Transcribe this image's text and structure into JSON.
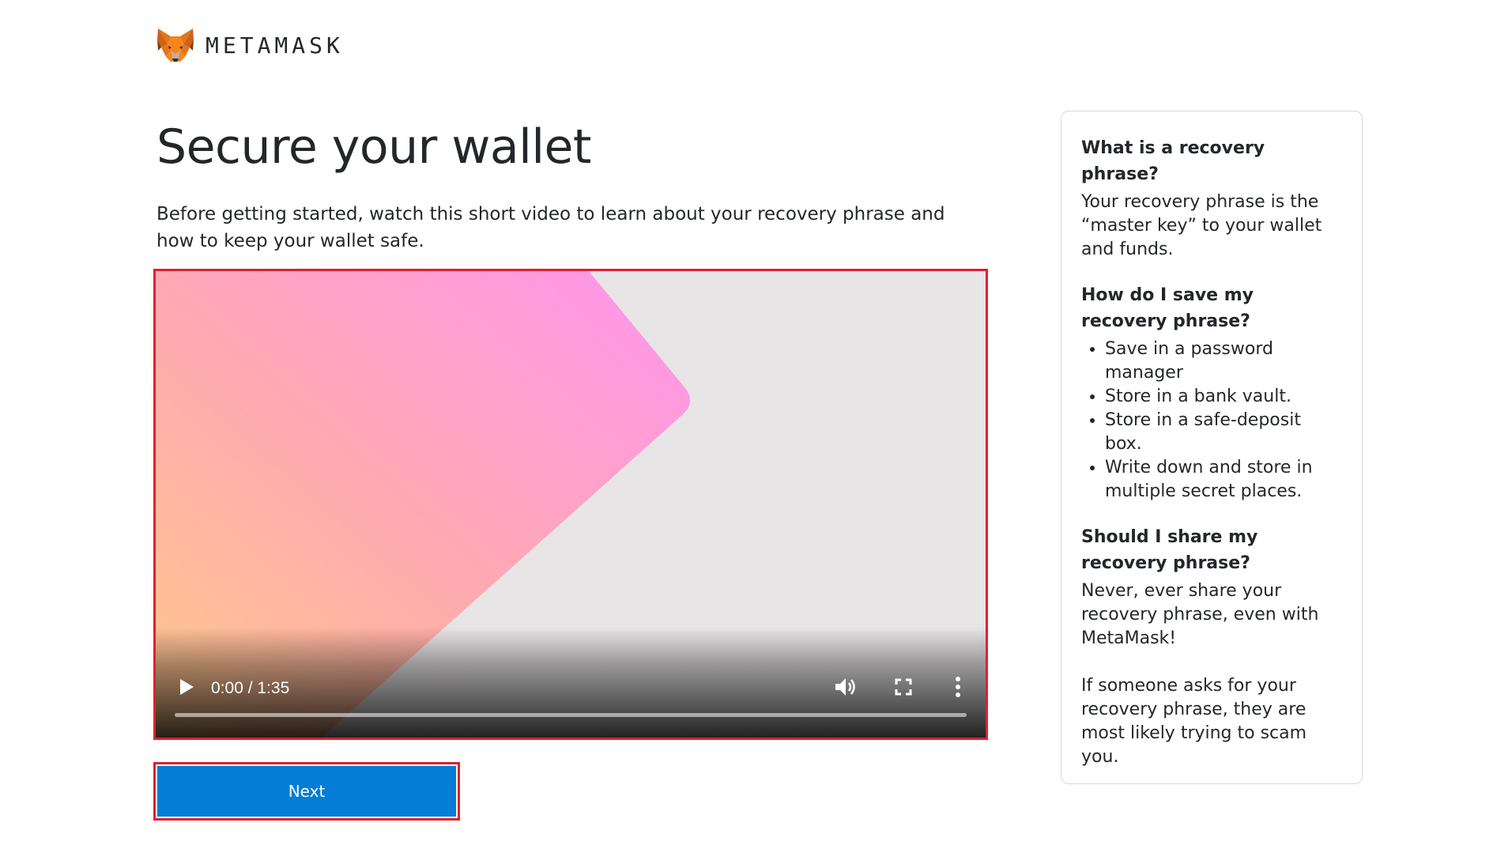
{
  "brand": {
    "name": "METAMASK",
    "logo_icon": "metamask-fox-icon",
    "fox_colors": [
      "#e2761b",
      "#cd6116",
      "#f6851b",
      "#763d16",
      "#233447",
      "#c0ad9e"
    ]
  },
  "main": {
    "title": "Secure your wallet",
    "intro": "Before getting started, watch this short video to learn about your recovery phrase and how to keep your wallet safe."
  },
  "video": {
    "time": "0:00 / 1:35",
    "progress": 0,
    "icons": {
      "play": "play-icon",
      "volume": "volume-icon",
      "fullscreen": "fullscreen-icon",
      "more": "more-vertical-icon"
    }
  },
  "next_button": {
    "label": "Next",
    "color": "#037dd6"
  },
  "sidebar": {
    "q1": {
      "heading": "What is a recovery phrase?",
      "text": "Your recovery phrase is the “master key” to your wallet and funds."
    },
    "q2": {
      "heading": "How do I save my recovery phrase?",
      "items": [
        "Save in a password manager",
        "Store in a bank vault.",
        "Store in a safe-deposit box.",
        "Write down and store in multiple secret places."
      ]
    },
    "q3": {
      "heading": "Should I share my recovery phrase?",
      "text": "Never, ever share your recovery phrase, even with MetaMask!",
      "text2": "If someone asks for your recovery phrase, they are most likely trying to scam you."
    }
  },
  "colors": {
    "highlight_border": "#e0202e",
    "text": "#24272a"
  }
}
